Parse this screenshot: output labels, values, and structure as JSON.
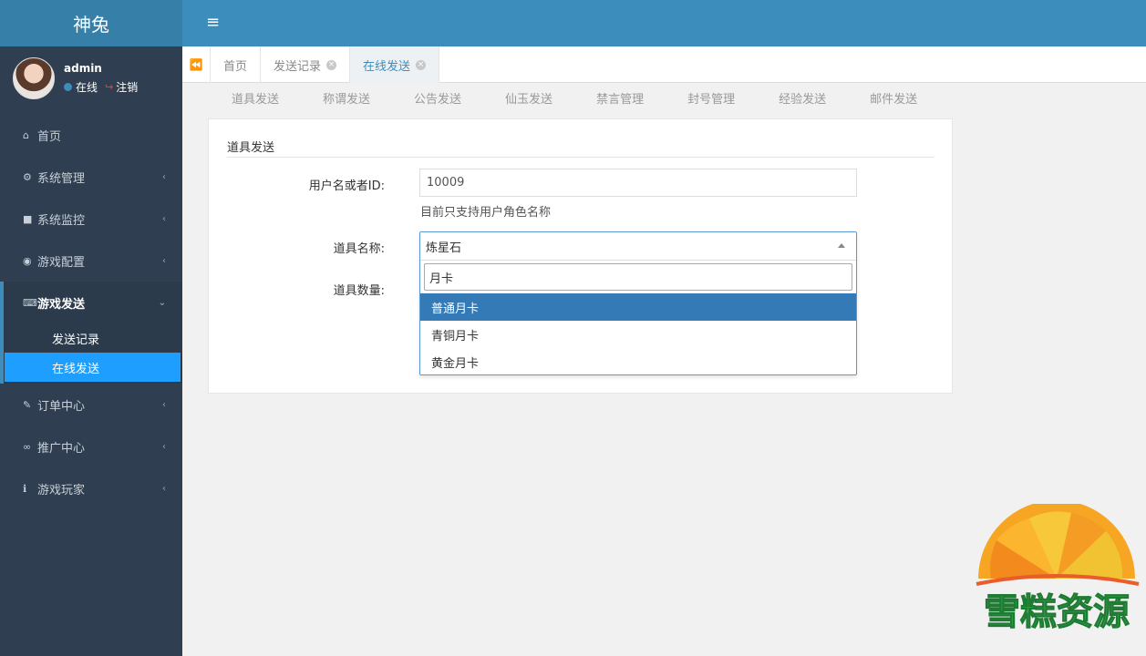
{
  "app": {
    "brand": "神兔",
    "menu_toggle_icon": "hamburger-icon"
  },
  "user": {
    "name": "admin",
    "status": "在线",
    "logout": "注销",
    "status_color": "#3c8dbc"
  },
  "sidebar": {
    "items": [
      {
        "icon": "home-icon",
        "label": "首页"
      },
      {
        "icon": "gear-icon",
        "label": "系统管理"
      },
      {
        "icon": "video-icon",
        "label": "系统监控"
      },
      {
        "icon": "gamepad-icon",
        "label": "游戏配置"
      },
      {
        "icon": "keyboard-icon",
        "label": "游戏发送",
        "sub": [
          "发送记录",
          "在线发送"
        ]
      },
      {
        "icon": "brush-icon",
        "label": "订单中心"
      },
      {
        "icon": "handshake-icon",
        "label": "推广中心"
      },
      {
        "icon": "person-icon",
        "label": "游戏玩家"
      }
    ]
  },
  "tabs": [
    {
      "label": "首页"
    },
    {
      "label": "发送记录"
    },
    {
      "label": "在线发送"
    }
  ],
  "subnav": [
    "道具发送",
    "称谓发送",
    "公告发送",
    "仙玉发送",
    "禁言管理",
    "封号管理",
    "经验发送",
    "邮件发送"
  ],
  "form": {
    "title": "道具发送",
    "user_label": "用户名或者ID:",
    "user_value": "10009",
    "user_help": "目前只支持用户角色名称",
    "item_label": "道具名称:",
    "qty_label": "道具数量:"
  },
  "select": {
    "current": "炼星石",
    "search": "月卡",
    "options": [
      "普通月卡",
      "青铜月卡",
      "黄金月卡"
    ]
  },
  "watermark": {
    "text": "雪糕资源"
  },
  "colors": {
    "topbar": "#3c8dbc",
    "sidebar": "#2f3e50",
    "active_sub": "#1e9fff",
    "highlight": "#337ab7"
  }
}
